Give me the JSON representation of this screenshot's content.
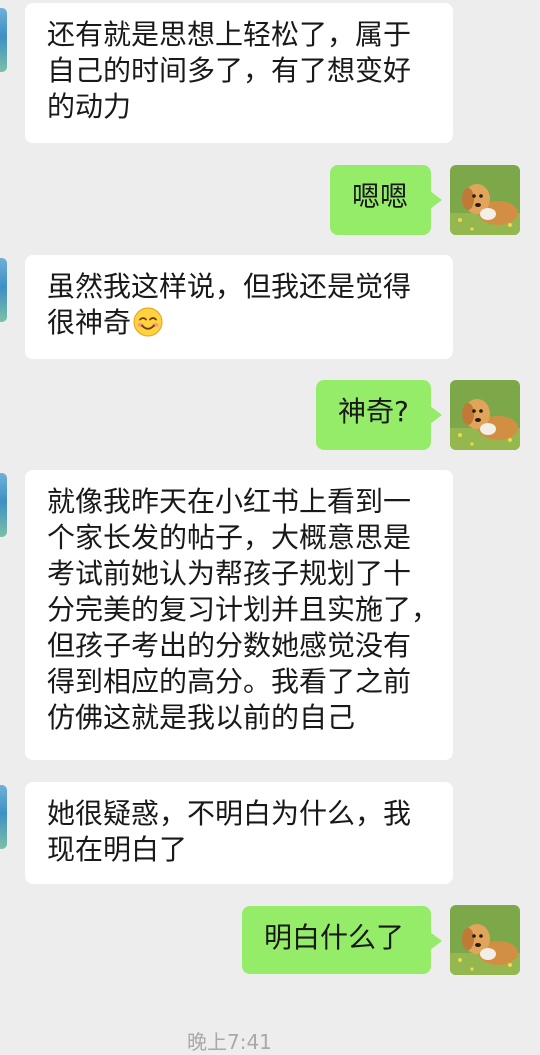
{
  "messages": [
    {
      "id": "m1",
      "side": "in",
      "lines": [
        "还有就是思想上轻松了，属于",
        "自己的时间多了，有了想变好",
        "的动力"
      ]
    },
    {
      "id": "m2",
      "side": "out",
      "text": "嗯嗯"
    },
    {
      "id": "m3",
      "side": "in",
      "lines": [
        "虽然我这样说，但我还是觉得",
        "很神奇"
      ],
      "emoji": "smiling-face-emoji"
    },
    {
      "id": "m4",
      "side": "out",
      "text": "神奇?"
    },
    {
      "id": "m5",
      "side": "in",
      "lines": [
        "就像我昨天在小红书上看到一",
        "个家长发的帖子，大概意思是",
        "考试前她认为帮孩子规划了十",
        "分完美的复习计划并且实施了，",
        "但孩子考出的分数她感觉没有",
        "得到相应的高分。我看了之前",
        "仿佛这就是我以前的自己"
      ]
    },
    {
      "id": "m6",
      "side": "in",
      "lines": [
        "她很疑惑，不明白为什么，我",
        "现在明白了"
      ]
    },
    {
      "id": "m7",
      "side": "out",
      "text": "明白什么了"
    }
  ],
  "timestamp": "晚上7:41",
  "colors": {
    "background": "#ededed",
    "incoming_bubble": "#ffffff",
    "outgoing_bubble": "#95ec69",
    "text": "#191919",
    "timestamp": "#a9a9a9"
  },
  "icons": {
    "contact_avatar": "contact-avatar-sky-icon",
    "self_avatar": "golden-retriever-avatar-icon"
  }
}
